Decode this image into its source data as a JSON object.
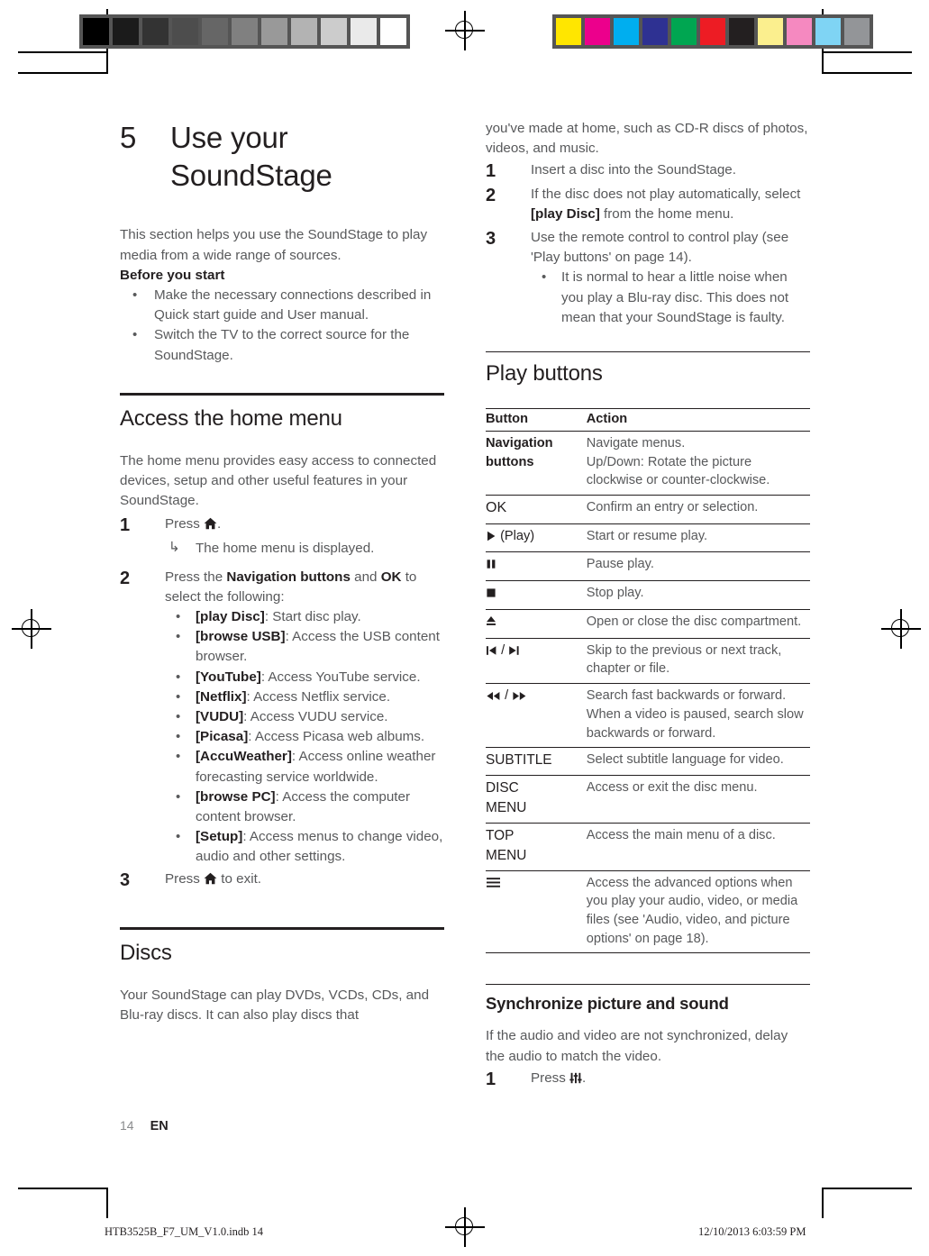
{
  "print_marks": {
    "grayscale_swatches": [
      "#000000",
      "#1b1b1b",
      "#333333",
      "#4d4d4d",
      "#666666",
      "#808080",
      "#999999",
      "#b3b3b3",
      "#cccccc",
      "#eaeaea",
      "#ffffff"
    ],
    "color_swatches": [
      "#ffe600",
      "#ec008c",
      "#00aeef",
      "#2e3192",
      "#00a651",
      "#ed1c24",
      "#231f20",
      "#fbef8e",
      "#f589c0",
      "#7fd4f4",
      "#939598"
    ]
  },
  "chapter": {
    "number": "5",
    "title": "Use your SoundStage"
  },
  "intro": {
    "paragraph": "This section helps you use the SoundStage to play media from a wide range of sources.",
    "before_you_start_label": "Before you start",
    "bullets": [
      "Make the necessary connections described in Quick start guide and User manual.",
      "Switch the TV to the correct source for the SoundStage."
    ]
  },
  "home_menu": {
    "heading": "Access the home menu",
    "intro": "The home menu provides easy access to connected devices, setup and other useful features in your SoundStage.",
    "step1": {
      "number": "1",
      "text_before": "Press ",
      "icon": "home-icon",
      "text_after": "."
    },
    "step1_result": "The home menu is displayed.",
    "step2": {
      "number": "2",
      "text": "Press the Navigation buttons and OK to select the following:",
      "bold_1": "Navigation buttons",
      "bold_2": "OK"
    },
    "menu_items": [
      {
        "key": "[play Disc]",
        "desc": ": Start disc play."
      },
      {
        "key": "[browse USB]",
        "desc": ": Access the USB content browser."
      },
      {
        "key": "[YouTube]",
        "desc": ": Access YouTube service."
      },
      {
        "key": "[Netflix]",
        "desc": ": Access Netflix service."
      },
      {
        "key": "[VUDU]",
        "desc": ": Access VUDU service."
      },
      {
        "key": "[Picasa]",
        "desc": ": Access Picasa web albums."
      },
      {
        "key": "[AccuWeather]",
        "desc": ": Access online weather forecasting service worldwide."
      },
      {
        "key": "[browse PC]",
        "desc": ": Access the computer content browser."
      },
      {
        "key": "[Setup]",
        "desc": ": Access menus to change video, audio and other settings."
      }
    ],
    "step3": {
      "number": "3",
      "text_before": "Press ",
      "icon": "home-icon",
      "text_after": " to exit."
    }
  },
  "discs": {
    "heading": "Discs",
    "paragraph": "Your SoundStage can play DVDs, VCDs, CDs, and Blu-ray discs. It can also play discs that you've made at home, such as CD-R discs of photos, videos, and music.",
    "steps": [
      {
        "number": "1",
        "text": "Insert a disc into the SoundStage."
      },
      {
        "number": "2",
        "text": "If the disc does not play automatically, select [play Disc] from the home menu.",
        "bold": "[play Disc]"
      },
      {
        "number": "3",
        "text": "Use the remote control to control play (see 'Play buttons' on page 14)."
      }
    ],
    "note": "It is normal to hear a little noise when you play a Blu-ray disc. This does not mean that your SoundStage is faulty."
  },
  "play_buttons": {
    "heading": "Play buttons",
    "columns": [
      "Button",
      "Action"
    ],
    "rows": [
      {
        "button": "Navigation buttons",
        "icon": "",
        "action": "Navigate menus.\nUp/Down: Rotate the picture clockwise or counter-clockwise."
      },
      {
        "button": "OK",
        "icon": "",
        "action": "Confirm an entry or selection."
      },
      {
        "button": " (Play)",
        "icon": "play-icon",
        "bold_suffix": "(Play)",
        "action": "Start or resume play."
      },
      {
        "button": "",
        "icon": "pause-icon",
        "action": "Pause play."
      },
      {
        "button": "",
        "icon": "stop-icon",
        "action": "Stop play."
      },
      {
        "button": "",
        "icon": "eject-icon",
        "action": "Open or close the disc compartment."
      },
      {
        "button": " / ",
        "icon": "skip-prev-next-icon",
        "action": "Skip to the previous or next track, chapter or file."
      },
      {
        "button": " / ",
        "icon": "rewind-fastforward-icon",
        "action": "Search fast backwards or forward. When a video is paused, search slow backwards or forward."
      },
      {
        "button": "SUBTITLE",
        "icon": "",
        "action": "Select subtitle language for video."
      },
      {
        "button": "DISC MENU",
        "icon": "",
        "action": "Access or exit the disc menu."
      },
      {
        "button": "TOP MENU",
        "icon": "",
        "action": "Access the main menu of a disc."
      },
      {
        "button": "",
        "icon": "options-menu-icon",
        "action": "Access the advanced options when you play your audio, video, or media files (see 'Audio, video, and picture options' on page 18)."
      }
    ]
  },
  "sync": {
    "heading": "Synchronize picture and sound",
    "paragraph": "If the audio and video are not synchronized, delay the audio to match the video.",
    "step1": {
      "number": "1",
      "text_before": "Press ",
      "icon": "sound-settings-icon",
      "text_after": "."
    }
  },
  "footer": {
    "page_number": "14",
    "language": "EN",
    "file_name": "HTB3525B_F7_UM_V1.0.indb   14",
    "timestamp": "12/10/2013   6:03:59 PM"
  }
}
